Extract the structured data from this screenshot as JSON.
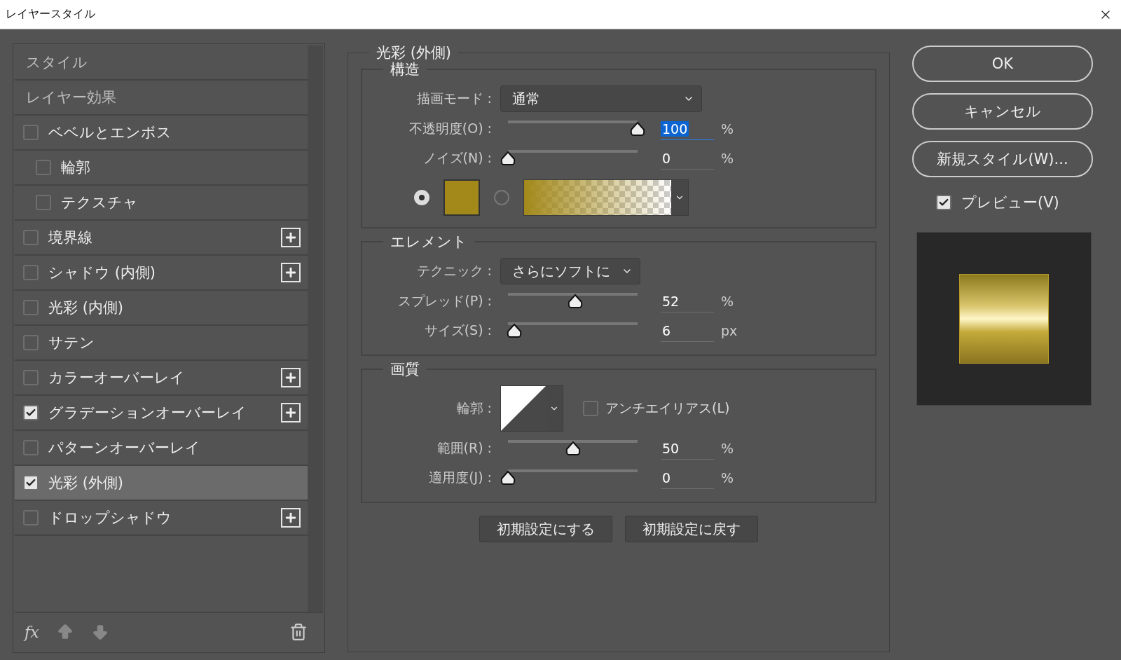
{
  "window": {
    "title": "レイヤースタイル"
  },
  "styles_list": {
    "items": [
      {
        "kind": "header",
        "label": "スタイル",
        "selected": false
      },
      {
        "kind": "header",
        "label": "レイヤー効果",
        "selected": false
      },
      {
        "kind": "effect",
        "label": "ベベルとエンボス",
        "checked": false,
        "selected": false,
        "add": false,
        "children": [
          {
            "kind": "effect",
            "label": "輪郭",
            "checked": false,
            "selected": false,
            "add": false
          },
          {
            "kind": "effect",
            "label": "テクスチャ",
            "checked": false,
            "selected": false,
            "add": false
          }
        ]
      },
      {
        "kind": "effect",
        "label": "境界線",
        "checked": false,
        "selected": false,
        "add": true
      },
      {
        "kind": "effect",
        "label": "シャドウ (内側)",
        "checked": false,
        "selected": false,
        "add": true
      },
      {
        "kind": "effect",
        "label": "光彩 (内側)",
        "checked": false,
        "selected": false,
        "add": false
      },
      {
        "kind": "effect",
        "label": "サテン",
        "checked": false,
        "selected": false,
        "add": false
      },
      {
        "kind": "effect",
        "label": "カラーオーバーレイ",
        "checked": false,
        "selected": false,
        "add": true
      },
      {
        "kind": "effect",
        "label": "グラデーションオーバーレイ",
        "checked": true,
        "selected": false,
        "add": true
      },
      {
        "kind": "effect",
        "label": "パターンオーバーレイ",
        "checked": false,
        "selected": false,
        "add": false
      },
      {
        "kind": "effect",
        "label": "光彩 (外側)",
        "checked": true,
        "selected": true,
        "add": false
      },
      {
        "kind": "effect",
        "label": "ドロップシャドウ",
        "checked": false,
        "selected": false,
        "add": true
      }
    ],
    "footer": {
      "fx": "fx"
    }
  },
  "outer_glow": {
    "title": "光彩 (外側)",
    "sections": [
      {
        "title": "構造",
        "rows": [
          {
            "kind": "select",
            "label": "描画モード :",
            "value": "通常"
          },
          {
            "kind": "slider",
            "label": "不透明度(O) :",
            "level": 1,
            "value": "100",
            "unit": "%",
            "focused": true
          },
          {
            "kind": "slider",
            "label": "ノイズ(N) :",
            "level": 0,
            "value": "0",
            "unit": "%",
            "focused": false
          },
          {
            "kind": "fill",
            "options": [
              {
                "kind": "color",
                "selected": true,
                "color": "#a3891a"
              },
              {
                "kind": "gradient",
                "selected": false
              }
            ]
          }
        ]
      },
      {
        "title": "エレメント",
        "rows": [
          {
            "kind": "select",
            "label": "テクニック :",
            "value": "さらにソフトに"
          },
          {
            "kind": "slider",
            "label": "スプレッド(P) :",
            "level": 0.52,
            "value": "52",
            "unit": "%",
            "focused": false
          },
          {
            "kind": "slider",
            "label": "サイズ(S) :",
            "level": 0.05,
            "value": "6",
            "unit": "px",
            "focused": false
          }
        ]
      },
      {
        "title": "画質",
        "rows": [
          {
            "kind": "contour",
            "label": "輪郭 :",
            "antialias": {
              "label": "アンチエイリアス(L)",
              "checked": false
            }
          },
          {
            "kind": "slider",
            "label": "範囲(R) :",
            "level": 0.5,
            "value": "50",
            "unit": "%",
            "focused": false
          },
          {
            "kind": "slider",
            "label": "適用度(J) :",
            "level": 0,
            "value": "0",
            "unit": "%",
            "focused": false
          }
        ]
      }
    ],
    "buttons": [
      "初期設定にする",
      "初期設定に戻す"
    ]
  },
  "actions": [
    "OK",
    "キャンセル",
    "新規スタイル(W)..."
  ],
  "preview": {
    "label": "プレビュー(V)",
    "checked": true
  }
}
